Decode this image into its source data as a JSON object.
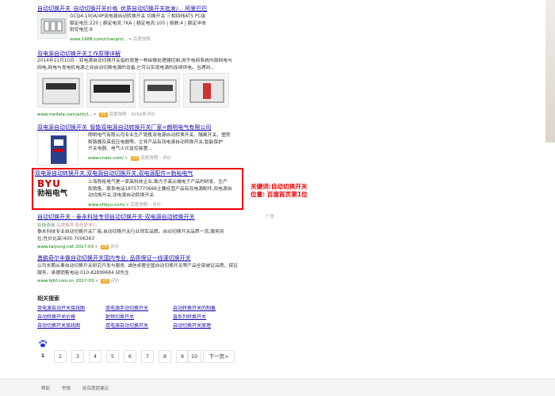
{
  "results": [
    {
      "title": "自动切换开关_自动切换开关价格_优质自动切换开关批发/... 阿里巴巴",
      "desc1": "GCQ4-100A/4P双电源自动转换开关 切换开关 三相四线ATS PC级",
      "desc2": "额定电压:220 | 额定电流:7KA | 额定电流:100 | 极数:4 | 额定冲击",
      "desc3": "耐受电压:8",
      "url": "www.1688.com/chanpin/...",
      "snapshot": "百度快照"
    },
    {
      "title": "双电源自动切换开关工作原理详解",
      "desc1": "2014年11月10日 - 双电源自动切换开关指的就是一种由微处理器控制,用于电网系统内部网电与",
      "desc2": "网电,网电与发电机电源之间自动切换电源的设备,它可以实现电源的连续供电。当遇到...",
      "url": "www.meilele.com/articl...",
      "snapshot": "百度快照",
      "eval": "4056条评价"
    },
    {
      "title": "双电源自动切换开关_智能双电源自动转换开关厂家=朗明电气有限公司",
      "desc1": "朗明电气有限公司专业生产销售双电源自动转换开关、隔离开关、塑壳",
      "desc2": "断路器及高低压电器等。主导产品有双电源自动转换开关,智能保护",
      "desc3": "开关电器、电气火灾监控装置...",
      "url": "www.cnats.com/",
      "snapshot": "百度快照",
      "eval": "评价"
    },
    {
      "title": "双电源自动转换开关,双电源自动切换开关,双电源配件=勃裕电气",
      "desc1": "上海勃裕电气是一家高科技企业,致力于高尖端电子产品的研发、生产",
      "desc2": "和销售。联系电话18757770666主要经营产品有双电源配件,双电源自",
      "desc3": "动切换开关,双电源自动转换开关",
      "url": "www.shbyu.com/",
      "snapshot": "百度快照",
      "eval": "评价",
      "logo_top": "BYU",
      "logo_bottom": "勃裕电气"
    },
    {
      "title": "自动切换开关 - 泰永科技专领自动切换开关-双电源自动转换开关",
      "desc1": "泰永科技专业自动切换开关厂商,自动切换开关行业领军品牌。自动切换开关品质一流,服务到",
      "desc2": "位,性价比高!400-7006363",
      "url": "www.taiyong.net",
      "date": "2017-03",
      "eval": "评价",
      "ad_tag": "广告",
      "credit": "在线咨询",
      "credit2": "品牌推荐 服务更放心"
    },
    {
      "title": "勇鹏奇尔丰霸自动切换开关国内专业, 品质保证一线谨切换开关",
      "desc1": "公司长期从事自动切换开关研究开发与服务, 诚信卓著全国自动切换开关等产品全部被证品质。保证",
      "desc2": "服务。承德销售电话:010-82899684 邱先生",
      "url": "www.bjhf.com.cn",
      "date": "2017-03",
      "eval": "评价"
    }
  ],
  "annotation": {
    "line1": "关键词:自动切换开关",
    "line2": "位置: 百度首页第1位"
  },
  "related": {
    "title": "相关搜索",
    "items": [
      "双电源自动开关接线图",
      "双电源手动切换开关",
      "自动转换开关的制备",
      "自动转换开关价格",
      "射频切换开关",
      "直系列转换开关",
      "自动切换开关接线图",
      "双电源自动切换开关",
      "自动切换开关原理"
    ]
  },
  "pagination": {
    "pages": [
      "1",
      "2",
      "3",
      "4",
      "5",
      "6",
      "7",
      "8",
      "9",
      "10"
    ],
    "next": "下一页>"
  },
  "footer": {
    "help": "帮助",
    "report": "举报",
    "feedback": "给百度提建议"
  },
  "icons": {
    "paw": "paw-icon",
    "v3": "V3",
    "dropdown": "dropdown-arrow-icon"
  },
  "colors": {
    "link": "#1a0dab",
    "url_green": "#008000",
    "highlight_red": "#ee0000"
  }
}
